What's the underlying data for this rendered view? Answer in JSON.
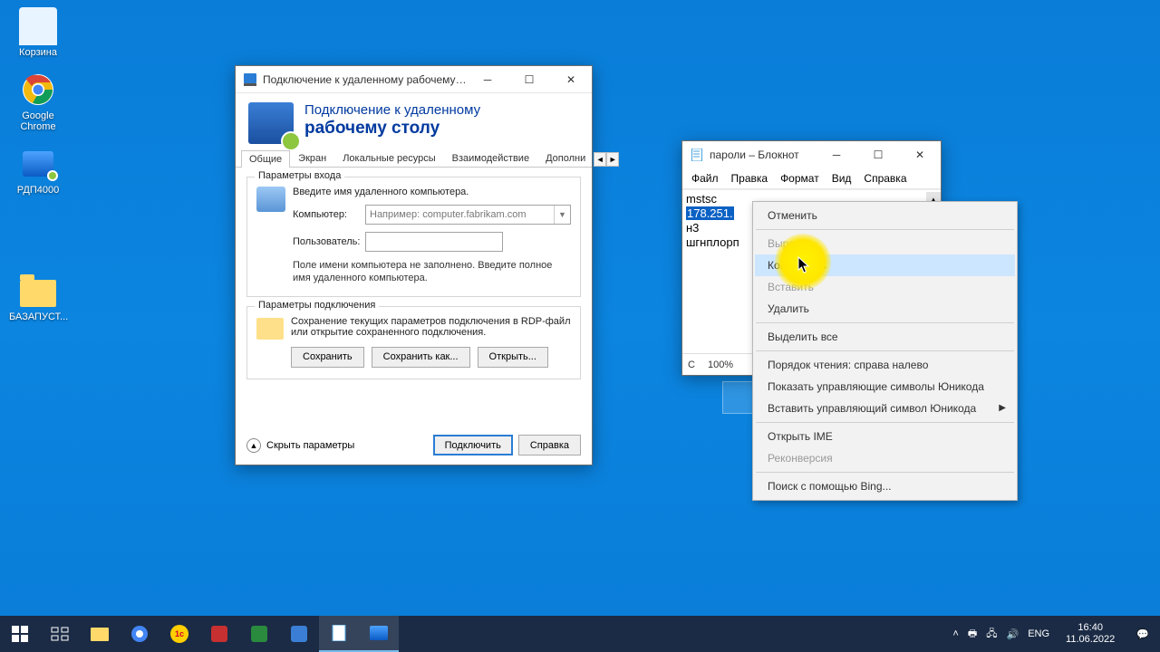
{
  "desktop_icons": {
    "recycle": "Корзина",
    "chrome": "Google Chrome",
    "rdp4000": "РДП4000",
    "folder": "БАЗАПУСТ..."
  },
  "rdp": {
    "title": "Подключение к удаленному рабочему с...",
    "head_line1": "Подключение к удаленному",
    "head_line2": "рабочему столу",
    "tabs": {
      "t1": "Общие",
      "t2": "Экран",
      "t3": "Локальные ресурсы",
      "t4": "Взаимодействие",
      "t5": "Дополни"
    },
    "login": {
      "legend": "Параметры входа",
      "intro": "Введите имя удаленного компьютера.",
      "computer_label": "Компьютер:",
      "computer_placeholder": "Например: computer.fabrikam.com",
      "user_label": "Пользователь:",
      "user_value": "",
      "hint": "Поле имени компьютера не заполнено. Введите полное имя удаленного компьютера."
    },
    "conn": {
      "legend": "Параметры подключения",
      "desc": "Сохранение текущих параметров подключения в RDP-файл или открытие сохраненного подключения.",
      "save": "Сохранить",
      "saveas": "Сохранить как...",
      "open": "Открыть..."
    },
    "bottom": {
      "hide": "Скрыть параметры",
      "connect": "Подключить",
      "help": "Справка"
    }
  },
  "notepad": {
    "title": "пароли – Блокнот",
    "menu": {
      "file": "Файл",
      "edit": "Правка",
      "format": "Формат",
      "view": "Вид",
      "help": "Справка"
    },
    "lines": {
      "l1": "mstsc",
      "l2_sel": "178.251.",
      "l3": "н3",
      "l4": "шгнплорп"
    },
    "status": {
      "col": "С",
      "zoom": "100%"
    }
  },
  "ctx": {
    "undo": "Отменить",
    "cut": "Вырезать",
    "copy": "Копировать",
    "paste": "Вставить",
    "delete": "Удалить",
    "selectall": "Выделить все",
    "rtl": "Порядок чтения: справа налево",
    "showuni": "Показать управляющие символы Юникода",
    "insuni": "Вставить управляющий символ Юникода",
    "ime": "Открыть IME",
    "reconv": "Реконверсия",
    "bing": "Поиск с помощью Bing..."
  },
  "taskbar": {
    "lang": "ENG",
    "time": "16:40",
    "date": "11.06.2022"
  }
}
